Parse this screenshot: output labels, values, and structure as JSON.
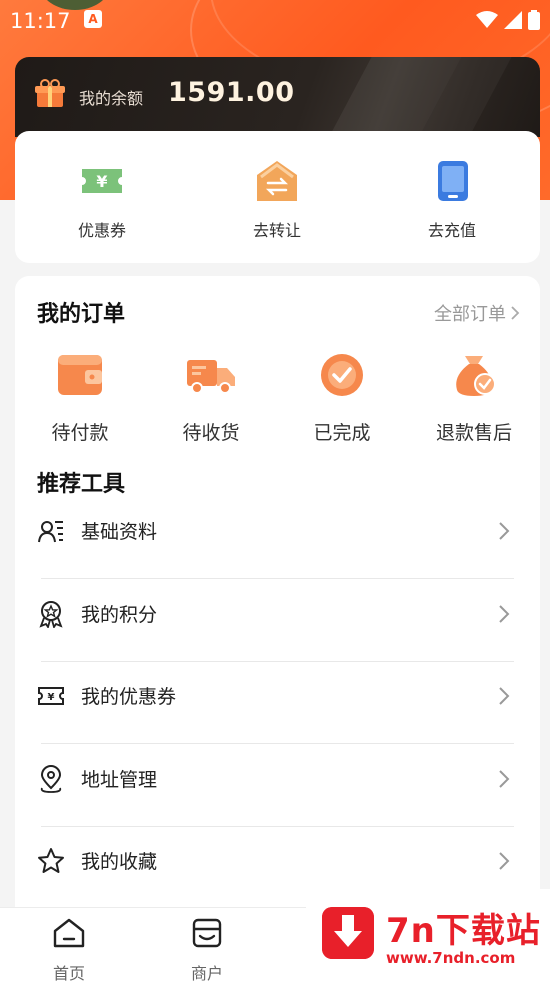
{
  "status_bar": {
    "time": "11:17",
    "notification_glyph": "A"
  },
  "balance": {
    "label": "我的余额",
    "value": "1591.00"
  },
  "quick_actions": [
    {
      "label": "优惠券",
      "icon": "coupon-icon"
    },
    {
      "label": "去转让",
      "icon": "transfer-icon"
    },
    {
      "label": "去充值",
      "icon": "phone-recharge-icon"
    }
  ],
  "orders": {
    "title": "我的订单",
    "all_label": "全部订单",
    "items": [
      {
        "label": "待付款",
        "icon": "wallet-icon"
      },
      {
        "label": "待收货",
        "icon": "truck-icon"
      },
      {
        "label": "已完成",
        "icon": "check-circle-icon"
      },
      {
        "label": "退款售后",
        "icon": "money-bag-icon"
      }
    ]
  },
  "tools": {
    "title": "推荐工具",
    "items": [
      {
        "label": "基础资料",
        "icon": "profile-card-icon"
      },
      {
        "label": "我的积分",
        "icon": "badge-icon"
      },
      {
        "label": "我的优惠券",
        "icon": "coupon-outline-icon"
      },
      {
        "label": "地址管理",
        "icon": "location-pin-icon"
      },
      {
        "label": "我的收藏",
        "icon": "star-icon"
      }
    ]
  },
  "bottom_nav": [
    {
      "label": "首页",
      "icon": "home-icon"
    },
    {
      "label": "商户",
      "icon": "store-icon"
    }
  ],
  "watermark": {
    "title": "7n下载站",
    "url": "www.7ndn.com"
  },
  "colors": {
    "accent": "#ff5a1f",
    "dark_card": "#221c19",
    "watermark_red": "#e8202a"
  }
}
